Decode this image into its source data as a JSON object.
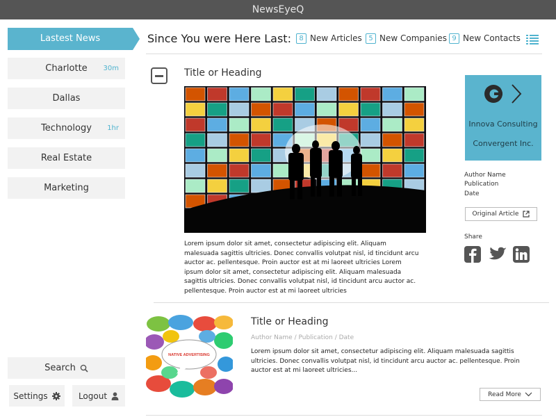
{
  "app": {
    "title": "NewsEyeQ"
  },
  "sidebar": {
    "active": {
      "label": "Lastest News"
    },
    "items": [
      {
        "label": "Charlotte",
        "badge": "30m"
      },
      {
        "label": "Dallas",
        "badge": ""
      },
      {
        "label": "Technology",
        "badge": "1hr"
      },
      {
        "label": "Real Estate",
        "badge": ""
      },
      {
        "label": "Marketing",
        "badge": ""
      }
    ],
    "search_label": "Search",
    "settings_label": "Settings",
    "logout_label": "Logout"
  },
  "header": {
    "since_label": "Since You were Here Last:",
    "new_articles": {
      "count": "8",
      "label": "New Articles"
    },
    "new_companies": {
      "count": "5",
      "label": "New Companies"
    },
    "new_contacts": {
      "count": "9",
      "label": "New Contacts"
    }
  },
  "article1": {
    "title": "Title or Heading",
    "body_lines": [
      "Lorem ipsum dolor sit amet, consectetur adipiscing elit. Aliquam",
      "malesuada sagittis ultricies. Donec convallis volutpat nisl, id tincidunt arcu",
      "auctor ac. pellentesque. Proin auctor est at mi laoreet ultricies Lorem",
      "ipsum dolor sit amet, consectetur adipiscing elit. Aliquam malesuada",
      "sagittis ultricies. Donec convallis volutpat nisl, id tincidunt arcu auctor ac.",
      "pellentesque. Proin auctor est at mi laoreet ultricies"
    ],
    "companies": [
      "Innova Consulting",
      "Convergent Inc."
    ],
    "author": "Author Name",
    "publication": "Publication",
    "date": "Date",
    "original_label": "Original Article",
    "share_label": "Share"
  },
  "article2": {
    "title": "Title or Heading",
    "meta": "Author Name / Publication  /  Date",
    "bubble_text": "NATIVE ADVERTISING",
    "body_lines": [
      "Lorem ipsum dolor sit amet, consectetur adipiscing elit. Aliquam malesuada sagittis",
      "ultricies. Donec convallis volutpat nisl, id tincidunt arcu auctor ac. pellentesque. Proin",
      "auctor est at mi laoreet ultricies..."
    ],
    "readmore_label": "Read More"
  },
  "colors": {
    "accent": "#5ab4ce",
    "titlebar": "#555555",
    "nav_bg": "#f2f2f2"
  }
}
